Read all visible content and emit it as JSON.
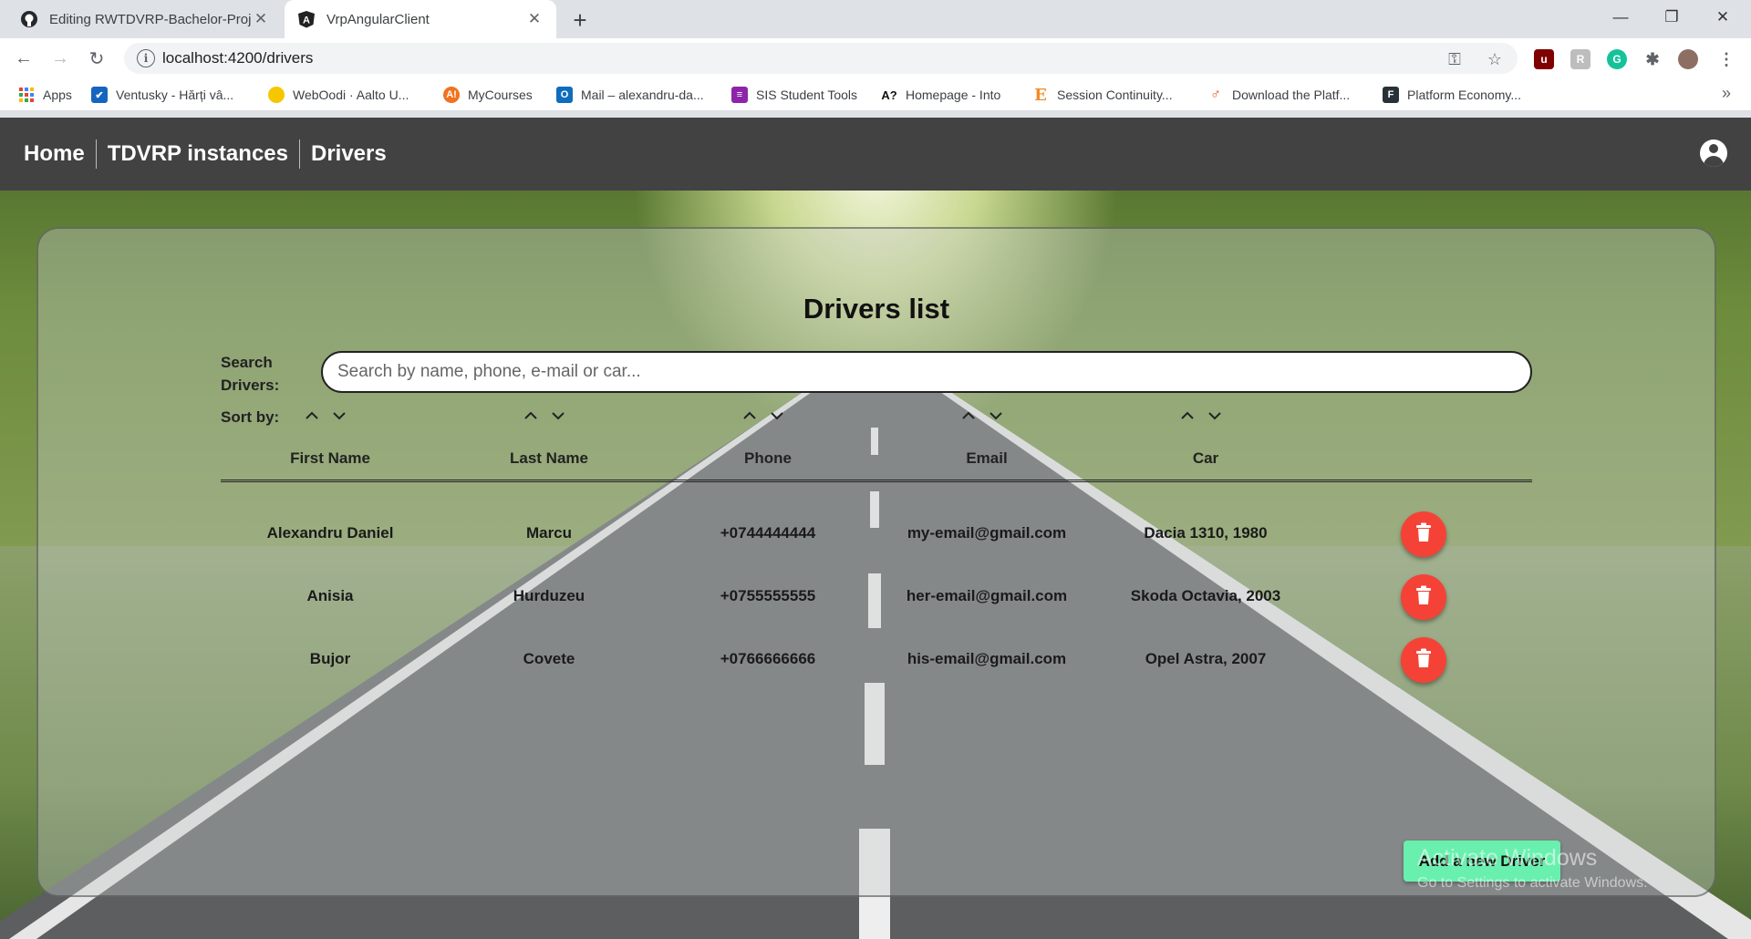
{
  "browser": {
    "tabs": [
      {
        "title": "Editing RWTDVRP-Bachelor-Proje",
        "favicon": "github-icon"
      },
      {
        "title": "VrpAngularClient",
        "favicon": "angular-icon"
      }
    ],
    "url": "localhost:4200/drivers",
    "bookmarks": [
      {
        "label": "Apps",
        "icon": "apps-grid-icon",
        "color": "#e8453c"
      },
      {
        "label": "Ventusky - Hărți vâ...",
        "icon": "ventusky-icon",
        "color": "#1565c0"
      },
      {
        "label": "WebOodi · Aalto U...",
        "icon": "weboodi-icon",
        "color": "#f6c700"
      },
      {
        "label": "MyCourses",
        "icon": "mycourses-icon",
        "color": "#f0731f"
      },
      {
        "label": "Mail – alexandru-da...",
        "icon": "outlook-icon",
        "color": "#0f6cbd"
      },
      {
        "label": "SIS Student Tools",
        "icon": "sis-icon",
        "color": "#8e24aa"
      },
      {
        "label": "Homepage - Into",
        "icon": "into-icon",
        "color": "#111111"
      },
      {
        "label": "Session Continuity...",
        "icon": "session-icon",
        "color": "#f28c28"
      },
      {
        "label": "Download the Platf...",
        "icon": "download-platform-icon",
        "color": "#e64a19"
      },
      {
        "label": "Platform Economy...",
        "icon": "platform-economy-icon",
        "color": "#263238"
      }
    ],
    "bookmarks_more": "»"
  },
  "navbar": {
    "links": [
      "Home",
      "TDVRP instances",
      "Drivers"
    ]
  },
  "main": {
    "title": "Drivers list",
    "search_label": "Search Drivers:",
    "search_placeholder": "Search by name, phone, e-mail or car...",
    "sort_label": "Sort by:",
    "columns": [
      "First Name",
      "Last Name",
      "Phone",
      "Email",
      "Car"
    ],
    "rows": [
      {
        "first_name": "Alexandru Daniel",
        "last_name": "Marcu",
        "phone": "+0744444444",
        "email": "my-email@gmail.com",
        "car": "Dacia 1310, 1980"
      },
      {
        "first_name": "Anisia",
        "last_name": "Hurduzeu",
        "phone": "+0755555555",
        "email": "her-email@gmail.com",
        "car": "Skoda Octavia, 2003"
      },
      {
        "first_name": "Bujor",
        "last_name": "Covete",
        "phone": "+0766666666",
        "email": "his-email@gmail.com",
        "car": "Opel Astra, 2007"
      }
    ],
    "add_button": "Add a new Driver"
  },
  "watermark": {
    "line1": "Activate Windows",
    "line2": "Go to Settings to activate Windows."
  },
  "colors": {
    "navbar": "#424242",
    "delete": "#f44336",
    "add": "#69f0ae"
  }
}
